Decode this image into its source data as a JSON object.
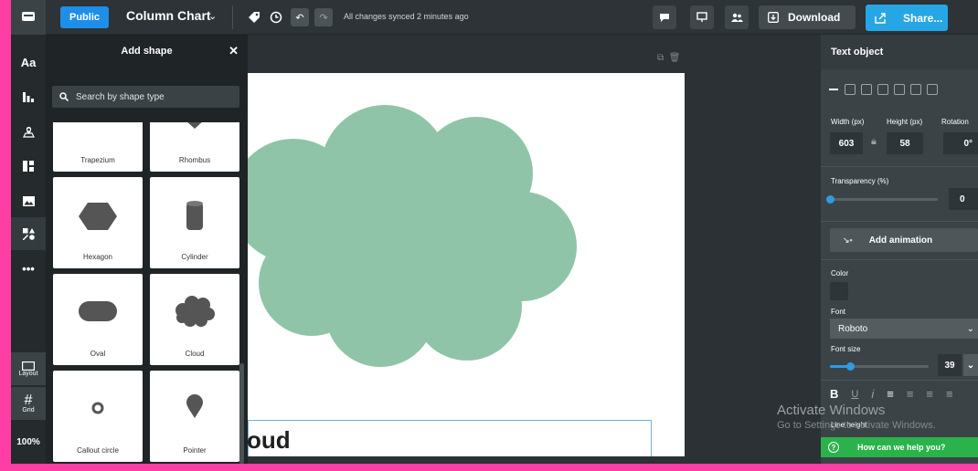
{
  "topbar": {
    "public_label": "Public",
    "project_title": "Column Chart",
    "sync_status": "All changes synced 2 minutes ago",
    "download_label": "Download",
    "share_label": "Share..."
  },
  "rail": {
    "items": [
      {
        "icon": "text-icon",
        "label": "Aa"
      },
      {
        "icon": "chart-icon"
      },
      {
        "icon": "map-icon"
      },
      {
        "icon": "layout-icon"
      },
      {
        "icon": "image-icon"
      },
      {
        "icon": "shapes-icon"
      },
      {
        "icon": "more-icon",
        "label": "•••"
      }
    ],
    "layout_label": "Layout",
    "grid_label": "Grid",
    "zoom": "100%"
  },
  "shape_panel": {
    "title": "Add shape",
    "search_placeholder": "Search by shape type",
    "shapes": [
      "Trapezium",
      "Rhombus",
      "Hexagon",
      "Cylinder",
      "Oval",
      "Cloud",
      "Callout circle",
      "Pointer"
    ]
  },
  "canvas": {
    "text_visible": "oud",
    "cloud_color": "#8fc4a8"
  },
  "properties": {
    "title": "Text object",
    "width_label": "Width (px)",
    "height_label": "Height (px)",
    "rotation_label": "Rotation",
    "width": "603",
    "height": "58",
    "rotation": "0°",
    "transparency_label": "Transparency (%)",
    "transparency": "0",
    "transparency_fraction": 0.0,
    "animation_label": "Add animation",
    "color_label": "Color",
    "font_label": "Font",
    "font_value": "Roboto",
    "font_size_label": "Font size",
    "font_size": "39",
    "font_size_fraction": 0.2,
    "line_height_label": "Line height",
    "help_label": "How can we help you?"
  },
  "watermark": {
    "line1": "Activate Windows",
    "line2": "Go to Settings to activate Windows."
  },
  "colors": {
    "accent": "#1d8fe8",
    "share": "#27a6e5",
    "help": "#2ab34a"
  }
}
